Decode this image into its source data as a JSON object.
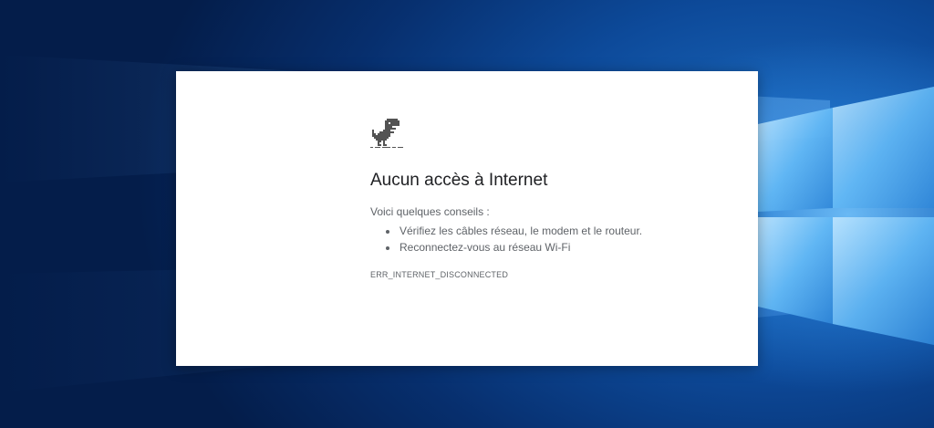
{
  "desktop": {
    "wallpaper": "windows-10-hero-blue",
    "accent_color": "#0d4a9a",
    "logo_color": "#7fd0ff"
  },
  "browser": {
    "icon": "dino-icon",
    "title": "Aucun accès à Internet",
    "intro": "Voici quelques conseils :",
    "tips": [
      "Vérifiez les câbles réseau, le modem et le routeur.",
      "Reconnectez-vous au réseau Wi-Fi"
    ],
    "error_code": "ERR_INTERNET_DISCONNECTED",
    "text_color": "#202124",
    "secondary_text_color": "#5f6368"
  }
}
